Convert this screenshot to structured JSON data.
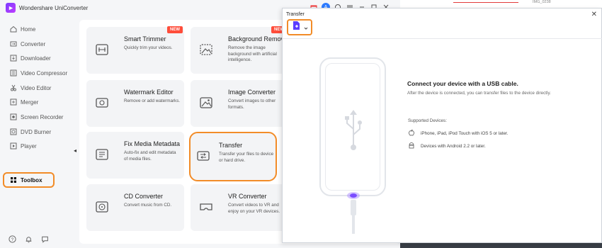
{
  "app": {
    "title": "Wondershare UniConverter",
    "avatar_initial": "A",
    "accent": "#f28c28"
  },
  "sidebar": {
    "items": [
      {
        "label": "Home",
        "icon": "home-icon"
      },
      {
        "label": "Converter",
        "icon": "converter-icon"
      },
      {
        "label": "Downloader",
        "icon": "download-icon"
      },
      {
        "label": "Video Compressor",
        "icon": "compress-icon"
      },
      {
        "label": "Video Editor",
        "icon": "scissors-icon"
      },
      {
        "label": "Merger",
        "icon": "merge-icon"
      },
      {
        "label": "Screen Recorder",
        "icon": "record-icon"
      },
      {
        "label": "DVD Burner",
        "icon": "disc-icon"
      },
      {
        "label": "Player",
        "icon": "play-icon"
      },
      {
        "label": "Toolbox",
        "icon": "grid-icon",
        "selected": true
      }
    ]
  },
  "tools": [
    {
      "title": "Smart Trimmer",
      "desc": "Quickly trim your videos.",
      "badge": "NEW"
    },
    {
      "title": "Background Remover",
      "desc": "Remove the image background with artificial intelligence.",
      "badge": "NEW"
    },
    {
      "title": "Watermark Editor",
      "desc": "Remove or add watermarks."
    },
    {
      "title": "Image Converter",
      "desc": "Convert images to other formats."
    },
    {
      "title": "Fix Media Metadata",
      "desc": "Auto-fix and edit metadata of media files."
    },
    {
      "title": "Transfer",
      "desc": "Transfer your files to device or hard drive.",
      "highlighted": true
    },
    {
      "title": "CD Converter",
      "desc": "Convert music from CD."
    },
    {
      "title": "VR Converter",
      "desc": "Convert videos to VR and enjoy on your VR devices."
    }
  ],
  "dialog": {
    "title": "Transfer",
    "connect_title": "Connect your device with a USB cable.",
    "connect_sub": "After the device is connected, you can transfer files to the device directly.",
    "supported_label": "Supported Devices:",
    "devices": [
      {
        "label": "iPhone, iPad, iPod Touch with iOS 5 or later.",
        "icon": "apple-icon"
      },
      {
        "label": "Devices with Android 2.2 or later.",
        "icon": "android-icon"
      }
    ]
  },
  "background": {
    "id_text": "IMG_0238"
  }
}
